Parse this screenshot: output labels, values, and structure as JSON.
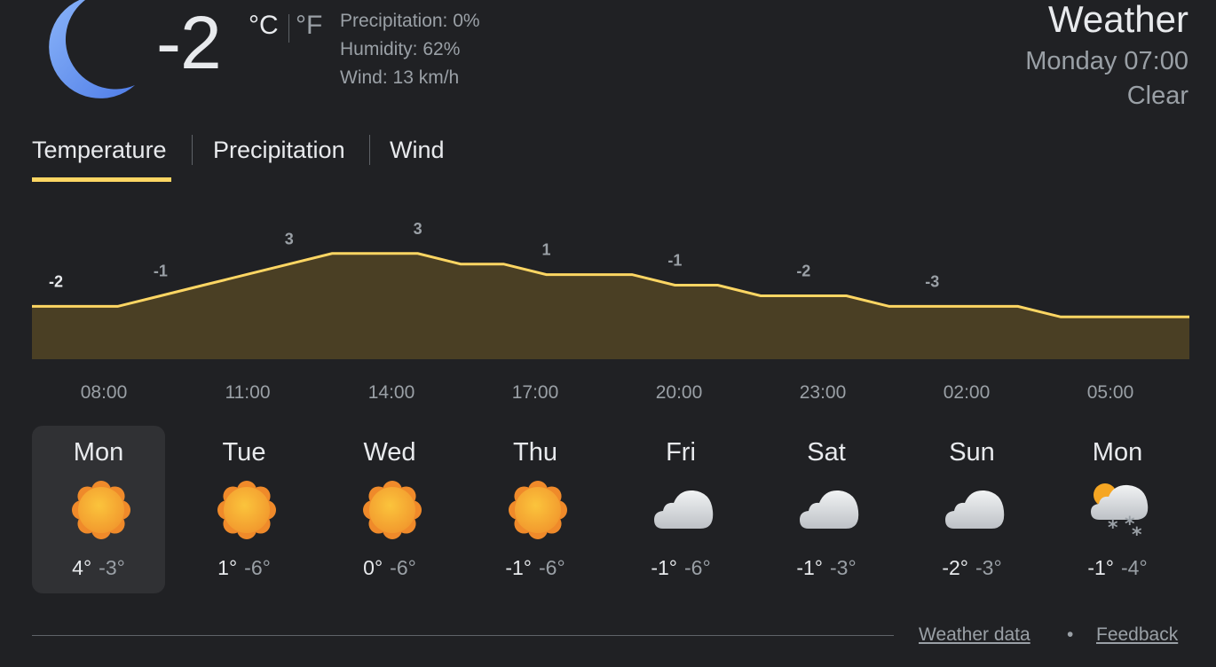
{
  "current": {
    "condition_icon": "moon-icon",
    "temperature": "-2",
    "unit_c": "°C",
    "unit_f": "°F",
    "precipitation": "Precipitation: 0%",
    "humidity": "Humidity: 62%",
    "wind": "Wind: 13 km/h"
  },
  "header": {
    "title": "Weather",
    "datetime": "Monday 07:00",
    "condition": "Clear"
  },
  "tabs": [
    {
      "label": "Temperature",
      "selected": true
    },
    {
      "label": "Precipitation",
      "selected": false
    },
    {
      "label": "Wind",
      "selected": false
    }
  ],
  "colors": {
    "accent": "#fdd663",
    "background": "#202124",
    "chart_fill": "#4a3f24",
    "text_primary": "#e8eaed",
    "text_secondary": "#9aa0a6"
  },
  "chart_data": {
    "type": "area",
    "series": [
      {
        "values": [
          -2,
          -2,
          -2,
          -1,
          0,
          1,
          2,
          3,
          3,
          3,
          2,
          2,
          1,
          1,
          1,
          0,
          0,
          -1,
          -1,
          -1,
          -2,
          -2,
          -2,
          -2,
          -3,
          -3,
          -3,
          -3
        ]
      }
    ],
    "labels": [
      "-2",
      "-1",
      "3",
      "3",
      "1",
      "-1",
      "-2",
      "-3"
    ],
    "x_tick_labels": [
      "08:00",
      "11:00",
      "14:00",
      "17:00",
      "20:00",
      "23:00",
      "02:00",
      "05:00"
    ],
    "ylim": [
      -7,
      6
    ],
    "grid": false
  },
  "forecast": [
    {
      "day": "Mon",
      "icon": "sun-icon",
      "hi": "4°",
      "lo": "-3°",
      "selected": true
    },
    {
      "day": "Tue",
      "icon": "sun-icon",
      "hi": "1°",
      "lo": "-6°",
      "selected": false
    },
    {
      "day": "Wed",
      "icon": "sun-icon",
      "hi": "0°",
      "lo": "-6°",
      "selected": false
    },
    {
      "day": "Thu",
      "icon": "sun-icon",
      "hi": "-1°",
      "lo": "-6°",
      "selected": false
    },
    {
      "day": "Fri",
      "icon": "cloud-icon",
      "hi": "-1°",
      "lo": "-6°",
      "selected": false
    },
    {
      "day": "Sat",
      "icon": "cloud-icon",
      "hi": "-1°",
      "lo": "-3°",
      "selected": false
    },
    {
      "day": "Sun",
      "icon": "cloud-icon",
      "hi": "-2°",
      "lo": "-3°",
      "selected": false
    },
    {
      "day": "Mon",
      "icon": "snow-cloud-icon",
      "hi": "-1°",
      "lo": "-4°",
      "selected": false
    }
  ],
  "footer": {
    "data_link": "Weather data",
    "separator": "•",
    "feedback_link": "Feedback"
  }
}
